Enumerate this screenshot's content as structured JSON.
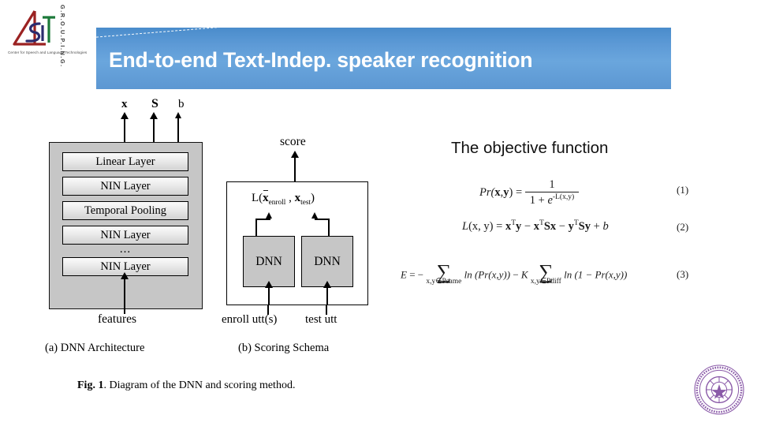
{
  "slide": {
    "banner_title": "End-to-end Text-Indep. speaker recognition",
    "banner_color": "#5c97d2"
  },
  "logo": {
    "name": "logo-cslt",
    "vertical_text": "G.R.O.U.P.I.N.G.",
    "tagline": "Center for Speech and Language Technologies"
  },
  "figure": {
    "dnn_panel": {
      "output_labels": [
        "x",
        "S",
        "b"
      ],
      "layers": [
        "Linear Layer",
        "NIN Layer",
        "Temporal Pooling",
        "NIN Layer",
        "NIN Layer"
      ],
      "ellipsis": "...",
      "input_label": "features"
    },
    "scoring_panel": {
      "output_label": "score",
      "loss_label": "L(x̄enroll , xtest)",
      "loss_main": "L(",
      "loss_x1": "x",
      "loss_sub1": "enroll",
      "loss_sep": " , ",
      "loss_x2": "x",
      "loss_sub2": "test",
      "loss_end": ")",
      "blocks": [
        "DNN",
        "DNN"
      ],
      "input_labels": [
        "enroll utt(s)",
        "test utt"
      ]
    },
    "subcaptions": [
      "(a) DNN Architecture",
      "(b) Scoring Schema"
    ],
    "caption_bold": "Fig. 1",
    "caption_rest": ". Diagram of the DNN and scoring method."
  },
  "objective": {
    "heading": "The objective function",
    "equations": [
      {
        "number": "(1)",
        "text": "Pr(x,y) = 1 / (1 + e^-L(x,y))"
      },
      {
        "number": "(2)",
        "text": "L(x, y) = x^T y - x^T Sx - y^T Sy + b"
      },
      {
        "number": "(3)",
        "text": "E = - sum_{x,y in P_same} ln(Pr(x,y)) - K sum_{x,y in P_diff} ln(1 - Pr(x,y))"
      }
    ],
    "eq1": {
      "lhs": "Pr(",
      "x": "x",
      "comma": ",",
      "y": "y",
      "rhs": ")",
      "eq": "=",
      "num": "1",
      "den_a": "1 + ",
      "den_e": "e",
      "den_exp": "-L(x,y)"
    },
    "eq2": {
      "lhs": "L",
      "args": "(x, y)",
      "eq": "=",
      "t1": "x",
      "t1s": "T",
      "t1b": "y",
      "m1": "−",
      "t2": "x",
      "t2s": "T",
      "t2b": "Sx",
      "m2": "−",
      "t3": "y",
      "t3s": "T",
      "t3b": "Sy",
      "p1": "+",
      "t4": "b"
    },
    "eq3": {
      "E": "E",
      "eq": "=",
      "minus1": "−",
      "sum1_lim": "x,y∈Psame",
      "ln1": "ln (Pr(x,y))",
      "minus2": "−",
      "K": "K",
      "sum2_lim": "x,y∈Pdiff",
      "ln2": "ln (1 − Pr(x,y))"
    }
  },
  "seal": {
    "name": "tsinghua-university-seal",
    "color": "#8a5aa8"
  }
}
